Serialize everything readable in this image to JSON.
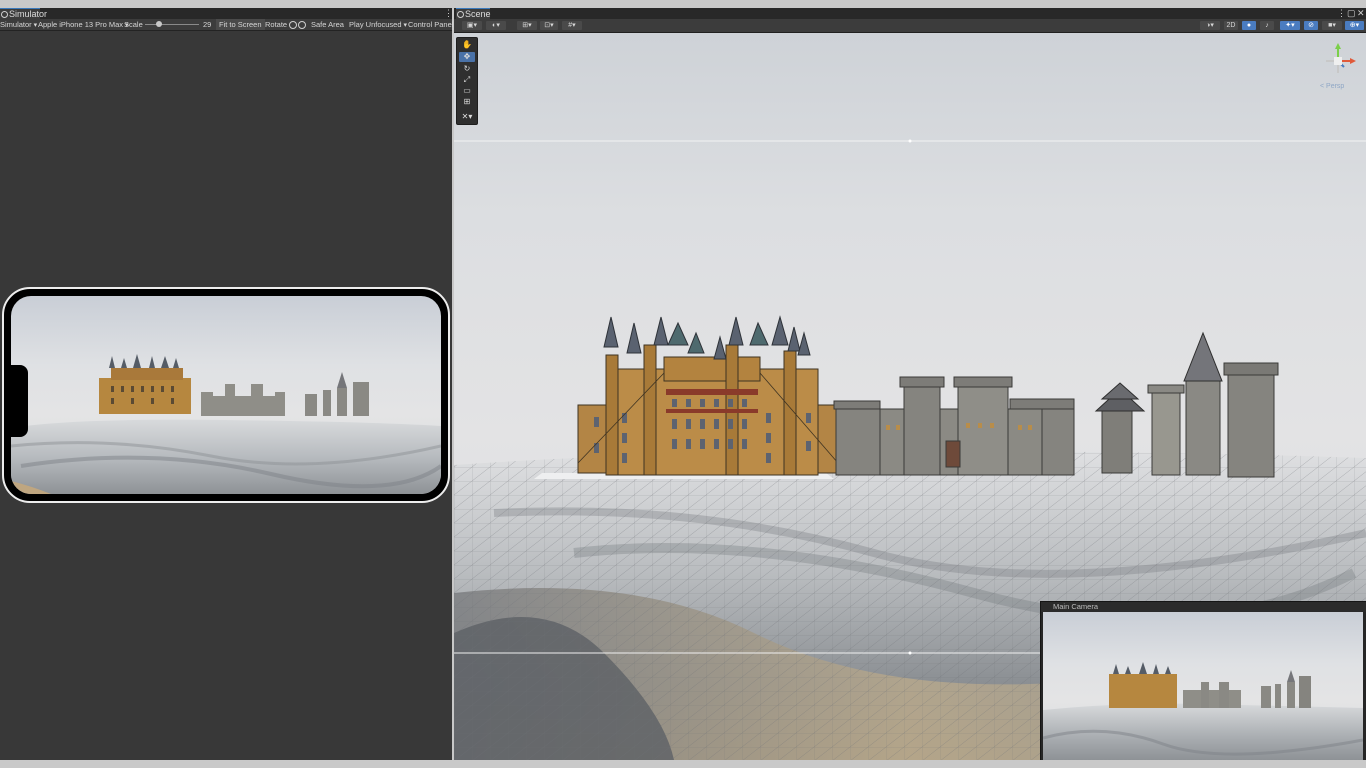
{
  "simulator": {
    "tab_title": "Simulator",
    "toolbar": {
      "mode": "Simulator",
      "device": "Apple iPhone 13 Pro Max",
      "scale_label": "Scale",
      "scale_value": "29",
      "fit_to_screen": "Fit to Screen",
      "rotate": "Rotate",
      "safe_area": "Safe Area",
      "play_focus": "Play Unfocused",
      "control_panel": "Control Panel"
    }
  },
  "scene": {
    "tab_title": "Scene",
    "toolbar": {
      "mode_2d": "2D"
    },
    "tools": [
      "hand-tool",
      "move-tool",
      "rotate-tool",
      "scale-tool",
      "rect-tool",
      "transform-tool",
      "custom-tool"
    ],
    "gizmo_label": "< Persp",
    "main_camera": {
      "title": "Main Camera"
    }
  },
  "colors": {
    "panel_bg": "#383838",
    "toolbar_bg": "#3c3c3c",
    "accent": "#4a7cc0",
    "castle_orange": "#b88a45",
    "stone": "#8d8c86"
  }
}
